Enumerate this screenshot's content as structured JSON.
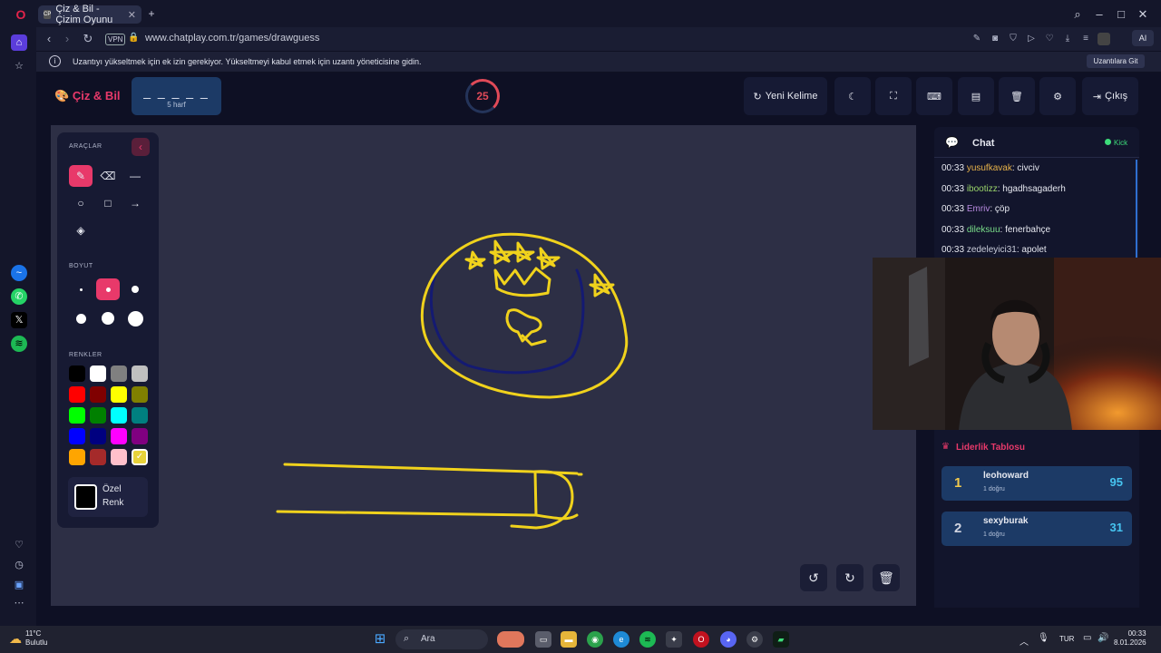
{
  "browser": {
    "tab_title": "Çiz & Bil - Çizim Oyunu",
    "favicon_text": "CP",
    "url": "www.chatplay.com.tr/games/drawguess",
    "vpn_label": "VPN",
    "ai_label": "AI",
    "info_message": "Uzantıyı yükseltmek için ek izin gerekiyor. Yükseltmeyi kabul etmek için uzantı yöneticisine gidin.",
    "info_button": "Uzantılara Git"
  },
  "app": {
    "logo": "Çiz & Bil",
    "word_mask": "_ _ _ _ _",
    "word_hint": "5 harf",
    "timer": "25",
    "toolbar": {
      "new_word": "Yeni Kelime",
      "exit": "Çıkış"
    }
  },
  "tools_panel": {
    "tools_label": "ARAÇLAR",
    "size_label": "BOYUT",
    "colors_label": "RENKLER",
    "custom_color_label_1": "Özel",
    "custom_color_label_2": "Renk",
    "colors": [
      "#000000",
      "#ffffff",
      "#808080",
      "#c0c0c0",
      "#ff0000",
      "#800000",
      "#ffff00",
      "#808000",
      "#00ff00",
      "#008000",
      "#00ffff",
      "#008080",
      "#0000ff",
      "#000080",
      "#ff00ff",
      "#800080",
      "#ffa500",
      "#a52a2a",
      "#ffc0cb",
      "#e8d23a"
    ],
    "selected_color": "#e8d23a"
  },
  "chat": {
    "title": "Chat",
    "status": "Kick",
    "messages": [
      {
        "time": "00:33",
        "user": "yusufkavak",
        "text": ": civciv",
        "color": "#e8b34a"
      },
      {
        "time": "00:33",
        "user": "ibootizz",
        "text": ": hgadhsagaderh",
        "color": "#9ad46a"
      },
      {
        "time": "00:33",
        "user": "Emriv",
        "text": ": çöp",
        "color": "#b88ae0"
      },
      {
        "time": "00:33",
        "user": "dileksuu",
        "text": ": fenerbahçe",
        "color": "#7adf8a"
      },
      {
        "time": "00:33",
        "user": "zedeleyici31",
        "text": ": apolet",
        "color": "#c9ccd9"
      }
    ]
  },
  "leaderboard": {
    "title": "Liderlik Tablosu",
    "rows": [
      {
        "rank": "1",
        "name": "leohoward",
        "sub": "1 doğru",
        "score": "95",
        "rank_color": "#f2c94c"
      },
      {
        "rank": "2",
        "name": "sexyburak",
        "sub": "1 doğru",
        "score": "31",
        "rank_color": "#d0d4e0"
      }
    ]
  },
  "taskbar": {
    "temp": "11°C",
    "weather": "Bulutlu",
    "search": "Ara",
    "lang": "TUR",
    "time": "00:33",
    "date": "8.01.2026"
  }
}
